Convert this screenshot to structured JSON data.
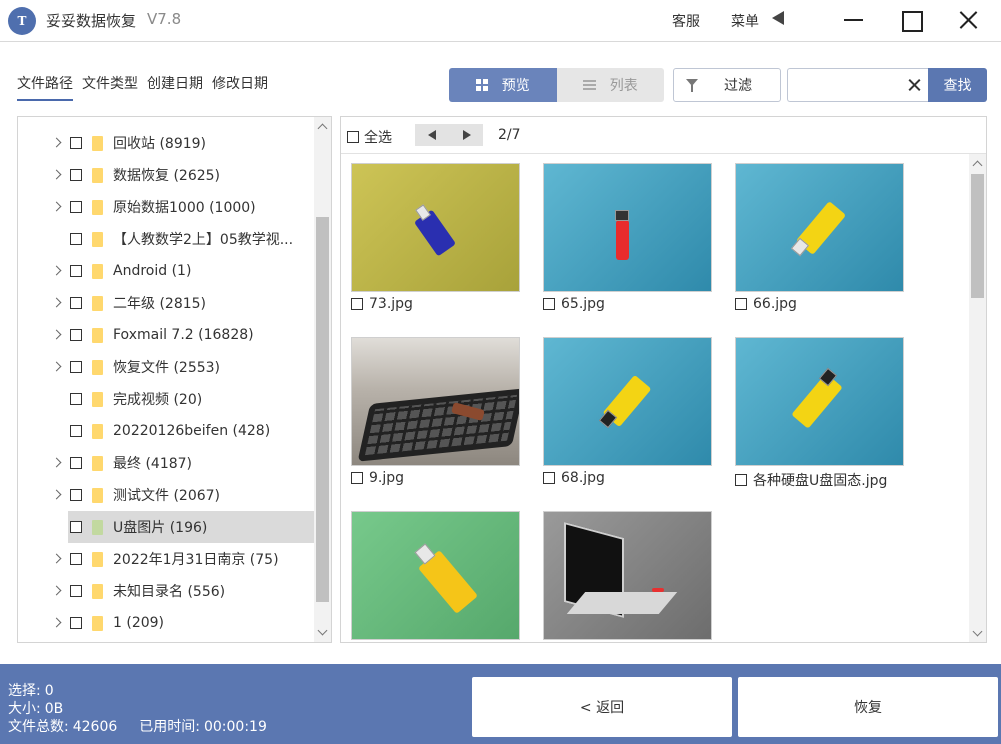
{
  "window": {
    "logo_text": "T",
    "title": "妥妥数据恢复",
    "version": "V7.8",
    "service_label": "客服",
    "menu_label": "菜单"
  },
  "tabs": [
    {
      "label": "文件路径",
      "active": true
    },
    {
      "label": "文件类型",
      "active": false
    },
    {
      "label": "创建日期",
      "active": false
    },
    {
      "label": "修改日期",
      "active": false
    }
  ],
  "toolbar": {
    "preview_label": "预览",
    "list_label": "列表",
    "filter_label": "过滤",
    "search_value": "",
    "search_button_label": "查找"
  },
  "tree": {
    "items": [
      {
        "label": "回收站  (8919)",
        "expandable": true,
        "selected": false
      },
      {
        "label": "数据恢复  (2625)",
        "expandable": true,
        "selected": false
      },
      {
        "label": "原始数据1000  (1000)",
        "expandable": true,
        "selected": false
      },
      {
        "label": "【人教数学2上】05教学视...",
        "expandable": false,
        "selected": false
      },
      {
        "label": "Android  (1)",
        "expandable": true,
        "selected": false
      },
      {
        "label": "二年级  (2815)",
        "expandable": true,
        "selected": false
      },
      {
        "label": "Foxmail 7.2  (16828)",
        "expandable": true,
        "selected": false
      },
      {
        "label": "恢复文件  (2553)",
        "expandable": true,
        "selected": false
      },
      {
        "label": "完成视频  (20)",
        "expandable": false,
        "selected": false
      },
      {
        "label": "20220126beifen  (428)",
        "expandable": false,
        "selected": false
      },
      {
        "label": "最终  (4187)",
        "expandable": true,
        "selected": false
      },
      {
        "label": "测试文件  (2067)",
        "expandable": true,
        "selected": false
      },
      {
        "label": "U盘图片  (196)",
        "expandable": false,
        "selected": true
      },
      {
        "label": "2022年1月31日南京  (75)",
        "expandable": true,
        "selected": false
      },
      {
        "label": "未知目录名  (556)",
        "expandable": true,
        "selected": false
      },
      {
        "label": "1  (209)",
        "expandable": true,
        "selected": false
      }
    ]
  },
  "preview": {
    "select_all_label": "全选",
    "page_indicator": "2/7",
    "thumbnails": [
      {
        "name": "73.jpg"
      },
      {
        "name": "65.jpg"
      },
      {
        "name": "66.jpg"
      },
      {
        "name": "9.jpg"
      },
      {
        "name": "68.jpg"
      },
      {
        "name": "各种硬盘U盘固态.jpg"
      },
      {
        "name": ""
      },
      {
        "name": ""
      }
    ]
  },
  "status": {
    "selected_label": "选择:",
    "selected_value": "0",
    "size_label": "大小:",
    "size_value": "0B",
    "total_label": "文件总数:",
    "total_value": "42606",
    "time_label": "已用时间:",
    "time_value": "00:00:19"
  },
  "footer": {
    "back_label": "< 返回",
    "recover_label": "恢复"
  },
  "colors": {
    "accent": "#5b77b1",
    "folder": "#ffd86e",
    "selected_row": "#dadada"
  }
}
